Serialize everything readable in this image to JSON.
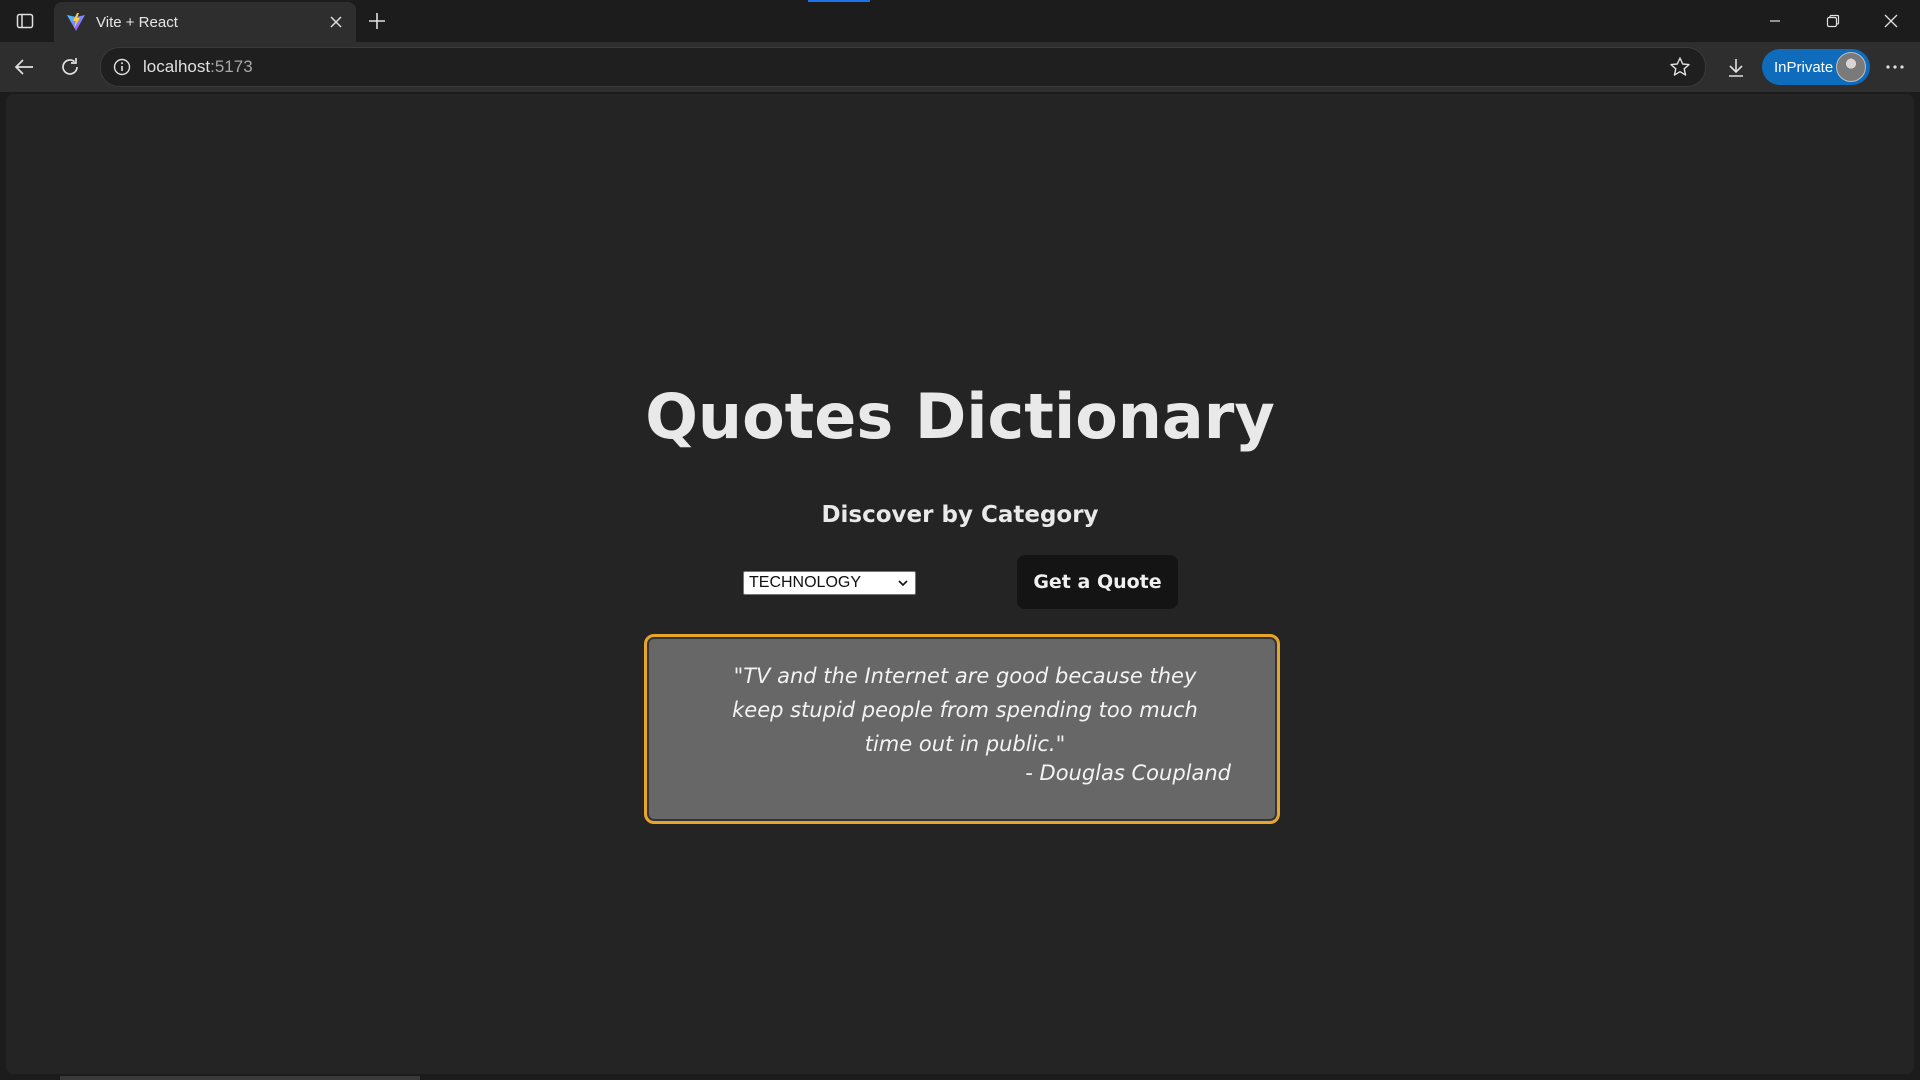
{
  "browser": {
    "tab": {
      "title": "Vite + React"
    },
    "address": {
      "host": "localhost",
      "port": ":5173"
    },
    "profile": {
      "label": "InPrivate"
    },
    "colors": {
      "accent": "#0f6cbd",
      "highlight_border": "#e9a52a"
    }
  },
  "page": {
    "title": "Quotes Dictionary",
    "subtitle": "Discover by Category",
    "category": {
      "selected": "TECHNOLOGY"
    },
    "button_label": "Get a Quote",
    "quote": {
      "text": "\"TV and the Internet are good because they keep stupid people from spending too much time out in public.\"",
      "author": "- Douglas Coupland"
    }
  }
}
